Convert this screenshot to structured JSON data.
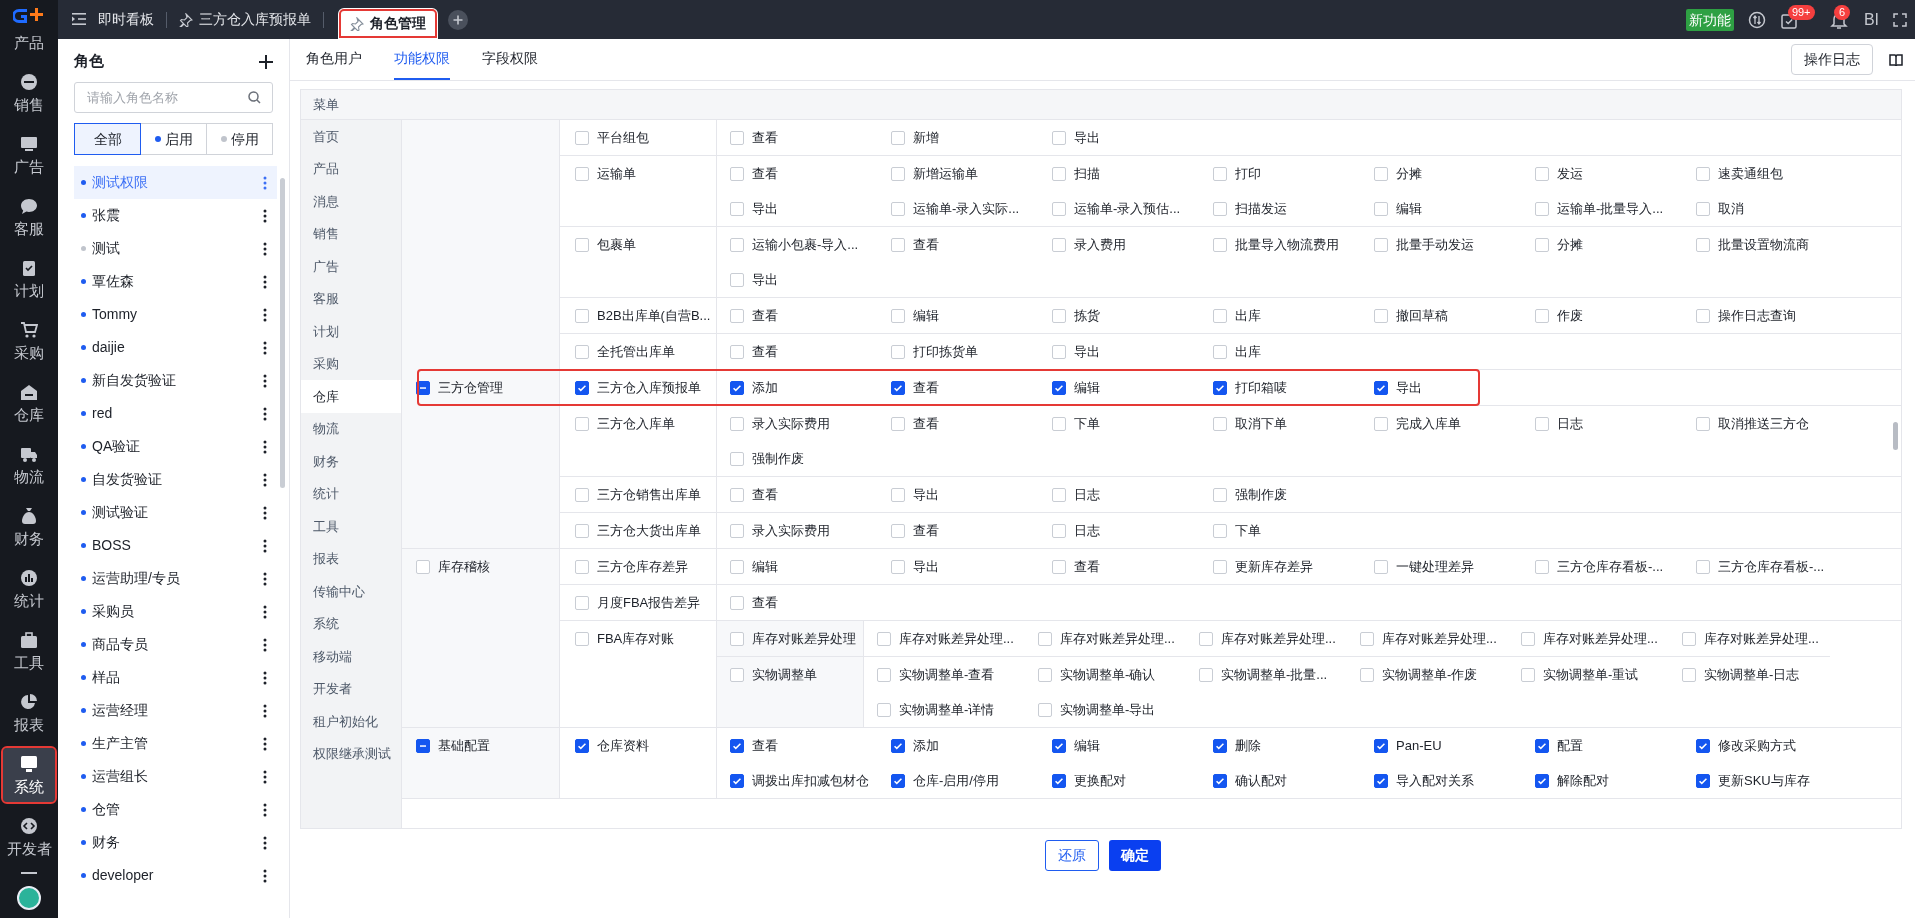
{
  "nav": {
    "items": [
      {
        "label": "产品",
        "selected": false,
        "highlighted": false
      },
      {
        "label": "销售",
        "selected": false,
        "highlighted": false
      },
      {
        "label": "广告",
        "selected": false,
        "highlighted": false
      },
      {
        "label": "客服",
        "selected": false,
        "highlighted": false
      },
      {
        "label": "计划",
        "selected": false,
        "highlighted": false
      },
      {
        "label": "采购",
        "selected": false,
        "highlighted": false
      },
      {
        "label": "仓库",
        "selected": false,
        "highlighted": false
      },
      {
        "label": "物流",
        "selected": false,
        "highlighted": false
      },
      {
        "label": "财务",
        "selected": false,
        "highlighted": false
      },
      {
        "label": "统计",
        "selected": false,
        "highlighted": false
      },
      {
        "label": "工具",
        "selected": false,
        "highlighted": false
      },
      {
        "label": "报表",
        "selected": false,
        "highlighted": false
      },
      {
        "label": "系统",
        "selected": true,
        "highlighted": true
      },
      {
        "label": "开发者",
        "selected": false,
        "highlighted": false
      }
    ]
  },
  "top_bar": {
    "tabs": [
      {
        "label": "即时看板",
        "pinned": false,
        "selected": false,
        "highlighted": false
      },
      {
        "label": "三方仓入库预报单",
        "pinned": true,
        "selected": false,
        "highlighted": false
      },
      {
        "label": "角色管理",
        "pinned": true,
        "selected": true,
        "highlighted": true
      }
    ],
    "new_feature": "新功能",
    "tasks_badge": "99+",
    "bell_badge": "6",
    "bi": "BI"
  },
  "roles": {
    "title": "角色",
    "search": {
      "placeholder": "请输入角色名称"
    },
    "filters": [
      {
        "label": "全部",
        "kind": "all",
        "selected": true
      },
      {
        "label": "启用",
        "kind": "enabled",
        "selected": false
      },
      {
        "label": "停用",
        "kind": "disabled",
        "selected": false
      }
    ],
    "items": [
      {
        "name": "测试权限",
        "enabled": true,
        "selected": true
      },
      {
        "name": "张震",
        "enabled": true,
        "selected": false
      },
      {
        "name": "测试",
        "enabled": false,
        "selected": false
      },
      {
        "name": "覃佐森",
        "enabled": true,
        "selected": false
      },
      {
        "name": "Tommy",
        "enabled": true,
        "selected": false
      },
      {
        "name": "daijie",
        "enabled": true,
        "selected": false
      },
      {
        "name": "新自发货验证",
        "enabled": true,
        "selected": false
      },
      {
        "name": "red",
        "enabled": true,
        "selected": false
      },
      {
        "name": "QA验证",
        "enabled": true,
        "selected": false
      },
      {
        "name": "自发货验证",
        "enabled": true,
        "selected": false
      },
      {
        "name": "测试验证",
        "enabled": true,
        "selected": false
      },
      {
        "name": "BOSS",
        "enabled": true,
        "selected": false
      },
      {
        "name": "运营助理/专员",
        "enabled": true,
        "selected": false
      },
      {
        "name": "采购员",
        "enabled": true,
        "selected": false
      },
      {
        "name": "商品专员",
        "enabled": true,
        "selected": false
      },
      {
        "name": "样品",
        "enabled": true,
        "selected": false
      },
      {
        "name": "运营经理",
        "enabled": true,
        "selected": false
      },
      {
        "name": "生产主管",
        "enabled": true,
        "selected": false
      },
      {
        "name": "运营组长",
        "enabled": true,
        "selected": false
      },
      {
        "name": "仓管",
        "enabled": true,
        "selected": false
      },
      {
        "name": "财务",
        "enabled": true,
        "selected": false
      },
      {
        "name": "developer",
        "enabled": true,
        "selected": false
      }
    ]
  },
  "tabs": [
    {
      "label": "角色用户",
      "selected": false
    },
    {
      "label": "功能权限",
      "selected": true
    },
    {
      "label": "字段权限",
      "selected": false
    }
  ],
  "log_button": "操作日志",
  "permissions": {
    "header": "菜单",
    "menu": [
      {
        "label": "首页",
        "selected": false
      },
      {
        "label": "产品",
        "selected": false
      },
      {
        "label": "消息",
        "selected": false
      },
      {
        "label": "销售",
        "selected": false
      },
      {
        "label": "广告",
        "selected": false
      },
      {
        "label": "客服",
        "selected": false
      },
      {
        "label": "计划",
        "selected": false
      },
      {
        "label": "采购",
        "selected": false
      },
      {
        "label": "仓库",
        "selected": true
      },
      {
        "label": "物流",
        "selected": false
      },
      {
        "label": "财务",
        "selected": false
      },
      {
        "label": "统计",
        "selected": false
      },
      {
        "label": "工具",
        "selected": false
      },
      {
        "label": "报表",
        "selected": false
      },
      {
        "label": "传输中心",
        "selected": false
      },
      {
        "label": "系统",
        "selected": false
      },
      {
        "label": "移动端",
        "selected": false
      },
      {
        "label": "开发者",
        "selected": false
      },
      {
        "label": "租户初始化",
        "selected": false
      },
      {
        "label": "权限继承测试",
        "selected": false
      }
    ],
    "groups": [
      {
        "label": "三方仓管理",
        "indeterminate": true,
        "rows": [
          {
            "label": "平台组包",
            "checked": false,
            "highlighted": false,
            "items": [
              {
                "label": "查看",
                "checked": false
              },
              {
                "label": "新增",
                "checked": false
              },
              {
                "label": "导出",
                "checked": false
              }
            ]
          },
          {
            "label": "运输单",
            "checked": false,
            "highlighted": false,
            "items": [
              {
                "label": "查看",
                "checked": false
              },
              {
                "label": "新增运输单",
                "checked": false
              },
              {
                "label": "扫描",
                "checked": false
              },
              {
                "label": "打印",
                "checked": false
              },
              {
                "label": "分摊",
                "checked": false
              },
              {
                "label": "发运",
                "checked": false
              },
              {
                "label": "速卖通组包",
                "checked": false
              },
              {
                "label": "导出",
                "checked": false
              },
              {
                "label": "运输单-录入实际...",
                "checked": false
              },
              {
                "label": "运输单-录入预估...",
                "checked": false
              },
              {
                "label": "扫描发运",
                "checked": false
              },
              {
                "label": "编辑",
                "checked": false
              },
              {
                "label": "运输单-批量导入...",
                "checked": false
              },
              {
                "label": "取消",
                "checked": false
              }
            ]
          },
          {
            "label": "包裹单",
            "checked": false,
            "highlighted": false,
            "items": [
              {
                "label": "运输小包裹-导入...",
                "checked": false
              },
              {
                "label": "查看",
                "checked": false
              },
              {
                "label": "录入费用",
                "checked": false
              },
              {
                "label": "批量导入物流费用",
                "checked": false
              },
              {
                "label": "批量手动发运",
                "checked": false
              },
              {
                "label": "分摊",
                "checked": false
              },
              {
                "label": "批量设置物流商",
                "checked": false
              },
              {
                "label": "导出",
                "checked": false
              }
            ]
          },
          {
            "label": "B2B出库单(自营B...",
            "checked": false,
            "highlighted": false,
            "items": [
              {
                "label": "查看",
                "checked": false
              },
              {
                "label": "编辑",
                "checked": false
              },
              {
                "label": "拣货",
                "checked": false
              },
              {
                "label": "出库",
                "checked": false
              },
              {
                "label": "撤回草稿",
                "checked": false
              },
              {
                "label": "作废",
                "checked": false
              },
              {
                "label": "操作日志查询",
                "checked": false
              }
            ]
          },
          {
            "label": "全托管出库单",
            "checked": false,
            "highlighted": false,
            "items": [
              {
                "label": "查看",
                "checked": false
              },
              {
                "label": "打印拣货单",
                "checked": false
              },
              {
                "label": "导出",
                "checked": false
              },
              {
                "label": "出库",
                "checked": false
              }
            ]
          },
          {
            "label": "三方仓入库预报单",
            "checked": true,
            "highlighted": true,
            "items": [
              {
                "label": "添加",
                "checked": true
              },
              {
                "label": "查看",
                "checked": true
              },
              {
                "label": "编辑",
                "checked": true
              },
              {
                "label": "打印箱唛",
                "checked": true
              },
              {
                "label": "导出",
                "checked": true
              }
            ]
          },
          {
            "label": "三方仓入库单",
            "checked": false,
            "highlighted": false,
            "items": [
              {
                "label": "录入实际费用",
                "checked": false
              },
              {
                "label": "查看",
                "checked": false
              },
              {
                "label": "下单",
                "checked": false
              },
              {
                "label": "取消下单",
                "checked": false
              },
              {
                "label": "完成入库单",
                "checked": false
              },
              {
                "label": "日志",
                "checked": false
              },
              {
                "label": "取消推送三方仓",
                "checked": false
              },
              {
                "label": "强制作废",
                "checked": false
              }
            ]
          },
          {
            "label": "三方仓销售出库单",
            "checked": false,
            "highlighted": false,
            "items": [
              {
                "label": "查看",
                "checked": false
              },
              {
                "label": "导出",
                "checked": false
              },
              {
                "label": "日志",
                "checked": false
              },
              {
                "label": "强制作废",
                "checked": false
              }
            ]
          },
          {
            "label": "三方仓大货出库单",
            "checked": false,
            "highlighted": false,
            "items": [
              {
                "label": "录入实际费用",
                "checked": false
              },
              {
                "label": "查看",
                "checked": false
              },
              {
                "label": "日志",
                "checked": false
              },
              {
                "label": "下单",
                "checked": false
              }
            ]
          }
        ]
      },
      {
        "label": "库存稽核",
        "indeterminate": false,
        "rows": [
          {
            "label": "三方仓库存差异",
            "checked": false,
            "highlighted": false,
            "items": [
              {
                "label": "编辑",
                "checked": false
              },
              {
                "label": "导出",
                "checked": false
              },
              {
                "label": "查看",
                "checked": false
              },
              {
                "label": "更新库存差异",
                "checked": false
              },
              {
                "label": "一键处理差异",
                "checked": false
              },
              {
                "label": "三方仓库存看板-...",
                "checked": false
              },
              {
                "label": "三方仓库存看板-...",
                "checked": false
              }
            ]
          },
          {
            "label": "月度FBA报告差异",
            "checked": false,
            "highlighted": false,
            "items": [
              {
                "label": "查看",
                "checked": false
              }
            ]
          },
          {
            "label": "FBA库存对账",
            "checked": false,
            "highlighted": false,
            "children": [
              {
                "label": "库存对账差异处理",
                "checked": false,
                "items": [
                  {
                    "label": "库存对账差异处理...",
                    "checked": false
                  },
                  {
                    "label": "库存对账差异处理...",
                    "checked": false
                  },
                  {
                    "label": "库存对账差异处理...",
                    "checked": false
                  },
                  {
                    "label": "库存对账差异处理...",
                    "checked": false
                  },
                  {
                    "label": "库存对账差异处理...",
                    "checked": false
                  },
                  {
                    "label": "库存对账差异处理...",
                    "checked": false
                  }
                ]
              },
              {
                "label": "实物调整单",
                "checked": false,
                "items": [
                  {
                    "label": "实物调整单-查看",
                    "checked": false
                  },
                  {
                    "label": "实物调整单-确认",
                    "checked": false
                  },
                  {
                    "label": "实物调整单-批量...",
                    "checked": false
                  },
                  {
                    "label": "实物调整单-作废",
                    "checked": false
                  },
                  {
                    "label": "实物调整单-重试",
                    "checked": false
                  },
                  {
                    "label": "实物调整单-日志",
                    "checked": false
                  },
                  {
                    "label": "实物调整单-详情",
                    "checked": false
                  },
                  {
                    "label": "实物调整单-导出",
                    "checked": false
                  }
                ]
              }
            ]
          }
        ]
      },
      {
        "label": "基础配置",
        "indeterminate": true,
        "rows": [
          {
            "label": "仓库资料",
            "checked": true,
            "highlighted": false,
            "items": [
              {
                "label": "查看",
                "checked": true
              },
              {
                "label": "添加",
                "checked": true
              },
              {
                "label": "编辑",
                "checked": true
              },
              {
                "label": "删除",
                "checked": true
              },
              {
                "label": "Pan-EU",
                "checked": true
              },
              {
                "label": "配置",
                "checked": true
              },
              {
                "label": "修改采购方式",
                "checked": true
              },
              {
                "label": "调拨出库扣减包材仓",
                "checked": true
              },
              {
                "label": "仓库-启用/停用",
                "checked": true
              },
              {
                "label": "更换配对",
                "checked": true
              },
              {
                "label": "确认配对",
                "checked": true
              },
              {
                "label": "导入配对关系",
                "checked": true
              },
              {
                "label": "解除配对",
                "checked": true
              },
              {
                "label": "更新SKU与库存",
                "checked": true
              }
            ]
          }
        ]
      }
    ]
  },
  "actions": {
    "reset": "还原",
    "confirm": "确定"
  }
}
